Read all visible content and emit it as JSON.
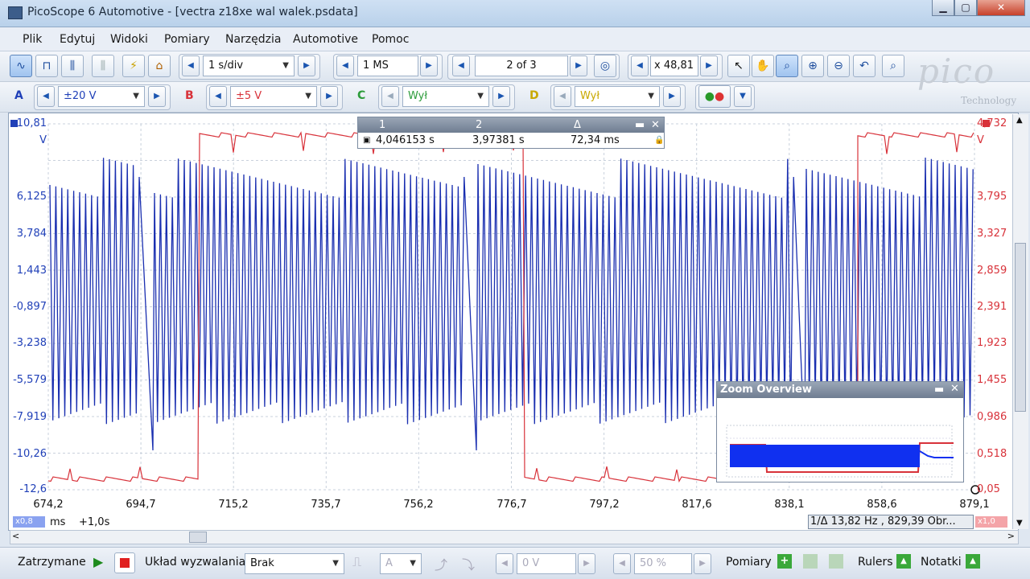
{
  "window": {
    "title": "PicoScope 6 Automotive - [vectra z18xe wal walek.psdata]",
    "minimize": "▁",
    "maximize": "▢",
    "close": "✕"
  },
  "menu": [
    "Plik",
    "Edytuj",
    "Widoki",
    "Pomiary",
    "Narzędzia",
    "Automotive",
    "Pomoc"
  ],
  "toolbar1": {
    "timebase": "1 s/div",
    "samples": "1 MS",
    "buffer": "2 of 3",
    "zoom": "x 48,81"
  },
  "channels": [
    {
      "letter": "A",
      "range": "±20 V",
      "color": "#2040b8"
    },
    {
      "letter": "B",
      "range": "±5 V",
      "color": "#d8323a"
    },
    {
      "letter": "C",
      "range": "Wył",
      "color": "#2d9c3b"
    },
    {
      "letter": "D",
      "range": "Wył",
      "color": "#c8a800"
    }
  ],
  "logo": {
    "word": "pico",
    "sub": "Technology"
  },
  "left_axis": {
    "ticks": [
      "10,81",
      "V",
      "6,125",
      "3,784",
      "1,443",
      "-0,897",
      "-3,238",
      "-5,579",
      "-7,919",
      "-10,26",
      "-12,6"
    ]
  },
  "right_axis": {
    "ticks": [
      "4,732",
      "V",
      "3,795",
      "3,327",
      "2,859",
      "2,391",
      "1,923",
      "1,455",
      "0,986",
      "0,518",
      "0,05"
    ]
  },
  "x_axis": {
    "ticks": [
      "674,2",
      "694,7",
      "715,2",
      "735,7",
      "756,2",
      "776,7",
      "797,2",
      "817,6",
      "838,1",
      "858,6",
      "879,1"
    ],
    "unit": "ms",
    "offset": "+1,0s",
    "zoom_left": "x0,8",
    "zoom_right": "x1,0"
  },
  "ruler_box": {
    "col1": "1",
    "col2": "2",
    "col3": "Δ",
    "val1": "4,046153 s",
    "val2": "3,97381 s",
    "val3": "72,34 ms"
  },
  "zoom_overview": {
    "title": "Zoom Overview"
  },
  "freq_readout": "13,82 Hz , 829,39 Obr...",
  "freq_prefix": "1/Δ",
  "status": {
    "state": "Zatrzymane",
    "trigger_label": "Układ wyzwalania",
    "trigger_mode": "Brak",
    "trigger_channel": "A",
    "trigger_level": "0 V",
    "trigger_pct": "50 %",
    "measurements": "Pomiary",
    "rulers": "Rulers",
    "notes": "Notatki"
  },
  "colors": {
    "channel_a": "#2040b8",
    "channel_b": "#d8323a"
  }
}
